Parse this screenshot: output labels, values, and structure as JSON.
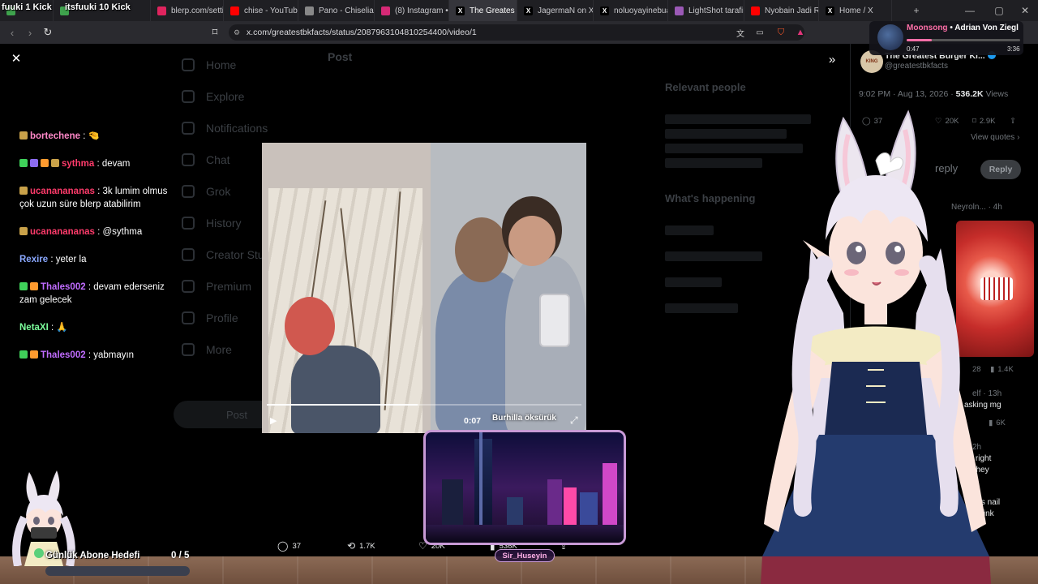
{
  "tabs": [
    {
      "label": "",
      "favicon_color": "#3fa34d"
    },
    {
      "label": "",
      "favicon_color": "#3fa34d"
    },
    {
      "label": "blerp.com/settin",
      "favicon_color": "#e0245e"
    },
    {
      "label": "chise - YouTube",
      "favicon_color": "#ff0000"
    },
    {
      "label": "Pano - Chiselia",
      "favicon_color": "#888888"
    },
    {
      "label": "(8) Instagram • M",
      "favicon_color": "#d62976"
    },
    {
      "label": "The Greates",
      "favicon_color": "#000000",
      "active": true
    },
    {
      "label": "JagermaN on X",
      "favicon_color": "#000000"
    },
    {
      "label": "noluoyayinebuar",
      "favicon_color": "#000000"
    },
    {
      "label": "LightShot tarafin",
      "favicon_color": "#9b59b6"
    },
    {
      "label": "Nyobain Jadi Ric",
      "favicon_color": "#ff0000"
    },
    {
      "label": "Home / X",
      "favicon_color": "#000000"
    }
  ],
  "kick_overlays": [
    "fuuki 1 Kick",
    "itsfuuki 10 Kick"
  ],
  "address_bar": {
    "url": "x.com/greatestbkfacts/status/2087963104810254400/video/1"
  },
  "music": {
    "artist": "Moonsong",
    "title": "• Adrian Von Ziegl",
    "elapsed": "0:47",
    "duration": "3:36",
    "progress": 0.22
  },
  "twitter_underlay": {
    "header": "Post",
    "nav": [
      "Home",
      "Explore",
      "Notifications",
      "Chat",
      "Grok",
      "History",
      "Creator Studio",
      "Premium",
      "Profile",
      "More"
    ],
    "post_button": "Post",
    "relevant_people": "Relevant people",
    "whats_happening": "What's happening"
  },
  "xpanel": {
    "avatar_text": "KING",
    "name": "The Greatest Burger Ki...",
    "handle": "@greatestbkfacts",
    "timestamp": "9:02 PM · Aug 13, 2026 · ",
    "views_count": "536.2K",
    "views_label": " Views",
    "stats": {
      "replies": "37",
      "likes": "20K",
      "bookmarks": "2.9K"
    },
    "view_quotes": "View quotes",
    "reply_placeholder": "reply",
    "reply_button": "Reply",
    "tweet_meta": "Neyroln... · 4h",
    "stat2_likes": "28",
    "stat2_views": "1.4K",
    "tweet3_meta": "elf · 13h",
    "tweet3_text": "asking mg",
    "stat3_views": "6K",
    "tweet4_meta": "2h",
    "tweet4_lines": [
      "he right",
      "re they"
    ],
    "tweet5_lines": [
      "er's nail",
      "I think"
    ]
  },
  "chat": [
    {
      "user": "bortechene",
      "color": "#ff88c8",
      "text": "",
      "badges": [
        "#c9a24a"
      ],
      "emote": "🤏"
    },
    {
      "user": "sythma",
      "color": "#ff3b6b",
      "text": "devam",
      "badges": [
        "#3fd15a",
        "#8c6cf0",
        "#ff9b2f",
        "#c9a24a"
      ]
    },
    {
      "user": "ucananananas",
      "color": "#ff3b6b",
      "text": "3k lumim olmus çok uzun süre blerp atabilirim",
      "badges": [
        "#c9a24a"
      ]
    },
    {
      "user": "ucananananas",
      "color": "#ff3b6b",
      "text": "@sythma",
      "badges": [
        "#c9a24a"
      ]
    },
    {
      "user": "Rexire",
      "color": "#8aa8ff",
      "text": "yeter la",
      "badges": []
    },
    {
      "user": "Thales002",
      "color": "#c06cff",
      "text": "devam ederseniz zam gelecek",
      "badges": [
        "#3fd15a",
        "#ff9b2f"
      ]
    },
    {
      "user": "NetaXI",
      "color": "#7cff9c",
      "text": "",
      "badges": [],
      "emote": "🙏"
    },
    {
      "user": "Thales002",
      "color": "#c06cff",
      "text": "yabmayın",
      "badges": [
        "#3fd15a",
        "#ff9b2f"
      ]
    }
  ],
  "video": {
    "time": "0:07",
    "progress": 0.48,
    "toast": "Burhilla öksürük"
  },
  "actions": {
    "replies": "37",
    "reposts": "1.7K",
    "likes": "20K",
    "views": "536K"
  },
  "cam_overlay": {
    "name": "Sir_Huseyin"
  },
  "goal": {
    "label": "Günlük Abone Hedefi",
    "count": "0 / 5",
    "progress": 0.0
  },
  "colors": {
    "accent": "#1d9bf0",
    "chat_bg": "#000000",
    "cam_border": "#c89ad6"
  }
}
